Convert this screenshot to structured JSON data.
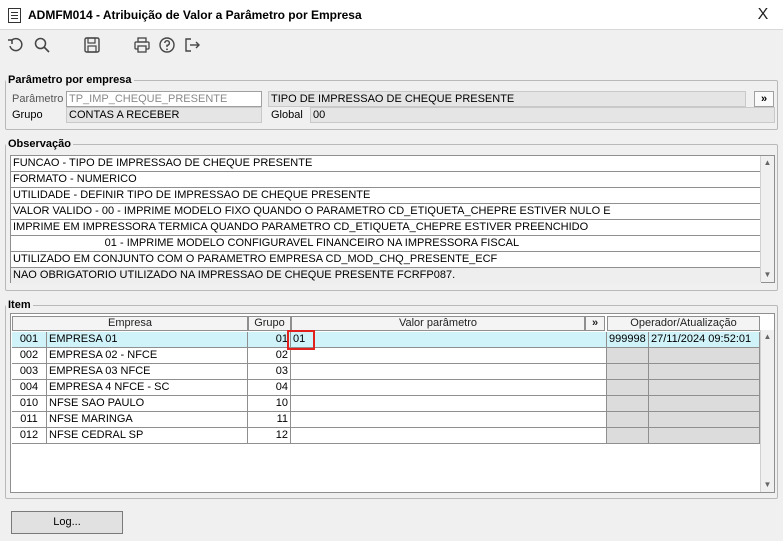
{
  "window": {
    "title": "ADMFM014 - Atribuição de Valor a Parâmetro por Empresa",
    "close_glyph": "X"
  },
  "toolbar": {
    "icons": [
      "undo-icon",
      "search-icon",
      "save-icon",
      "print-icon",
      "help-icon",
      "exit-icon"
    ]
  },
  "parametro": {
    "legend": "Parâmetro por empresa",
    "parametro_label": "Parâmetro",
    "parametro_value": "TP_IMP_CHEQUE_PRESENTE",
    "descricao_value": "TIPO DE IMPRESSAO DE CHEQUE PRESENTE",
    "more_button": "»",
    "grupo_label": "Grupo",
    "grupo_value": "CONTAS A RECEBER",
    "global_label": "Global",
    "global_value": "00"
  },
  "observacao": {
    "legend": "Observação",
    "lines": [
      "FUNCAO - TIPO DE IMPRESSAO DE CHEQUE PRESENTE",
      "FORMATO - NUMERICO",
      "UTILIDADE - DEFINIR TIPO DE IMPRESSAO DE CHEQUE PRESENTE",
      "VALOR VALIDO -  00 - IMPRIME MODELO FIXO QUANDO O PARAMETRO CD_ETIQUETA_CHEPRE ESTIVER NULO E",
      " IMPRIME EM IMPRESSORA TERMICA QUANDO PARAMETRO CD_ETIQUETA_CHEPRE ESTIVER PREENCHIDO",
      "                              01 - IMPRIME MODELO CONFIGURAVEL FINANCEIRO NA IMPRESSORA FISCAL",
      "UTILIZADO EM CONJUNTO COM O PARAMETRO EMPRESA CD_MOD_CHQ_PRESENTE_ECF",
      "NAO OBRIGATORIO UTILIZADO NA IMPRESSAO DE CHEQUE PRESENTE FCRFP087."
    ]
  },
  "item": {
    "legend": "Item",
    "headers": {
      "empresa": "Empresa",
      "grupo": "Grupo",
      "valor": "Valor parâmetro",
      "more": "»",
      "operador": "Operador/Atualização"
    },
    "rows": [
      {
        "code": "001",
        "name": "EMPRESA 01",
        "grupo": "01",
        "valor": "01",
        "operador": "999998",
        "data": "27/11/2024 09:52:01"
      },
      {
        "code": "002",
        "name": "EMPRESA 02 - NFCE",
        "grupo": "02",
        "valor": "",
        "operador": "",
        "data": ""
      },
      {
        "code": "003",
        "name": "EMPRESA 03 NFCE",
        "grupo": "03",
        "valor": "",
        "operador": "",
        "data": ""
      },
      {
        "code": "004",
        "name": "EMPRESA 4 NFCE - SC",
        "grupo": "04",
        "valor": "",
        "operador": "",
        "data": ""
      },
      {
        "code": "010",
        "name": "NFSE SAO PAULO",
        "grupo": "10",
        "valor": "",
        "operador": "",
        "data": ""
      },
      {
        "code": "011",
        "name": "NFSE MARINGA",
        "grupo": "11",
        "valor": "",
        "operador": "",
        "data": ""
      },
      {
        "code": "012",
        "name": "NFSE CEDRAL SP",
        "grupo": "12",
        "valor": "",
        "operador": "",
        "data": ""
      }
    ]
  },
  "footer": {
    "log_button": "Log..."
  }
}
